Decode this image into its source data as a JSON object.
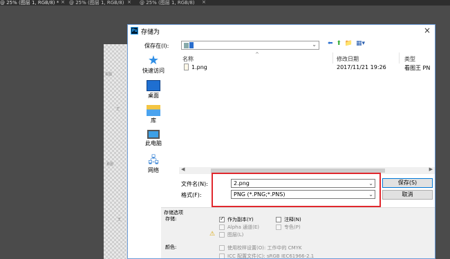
{
  "ps_tabs": [
    {
      "label": "@ 25% (图层 1, RGB/8) *",
      "active": true
    },
    {
      "label": "@ 25% (图层 1, RGB/8)",
      "active": false
    },
    {
      "label": "@ 25% (图层 1, RGB/8)",
      "active": false
    }
  ],
  "canvas_text": [
    "看图",
    "王",
    "看图",
    "王"
  ],
  "dialog": {
    "title": "存储为",
    "logo_text": "Ps",
    "close_label": "×",
    "save_in_label": "保存在(I):",
    "save_in_value": "",
    "toolbar": {
      "back": "⬅",
      "up": "⬆",
      "new_folder": "📁",
      "views": "▦▾"
    }
  },
  "places": [
    {
      "label": "快速访问",
      "icon": "star-icon"
    },
    {
      "label": "桌面",
      "icon": "desktop-icon"
    },
    {
      "label": "库",
      "icon": "library-icon"
    },
    {
      "label": "此电脑",
      "icon": "computer-icon"
    },
    {
      "label": "网络",
      "icon": "network-icon"
    }
  ],
  "file_list": {
    "columns": [
      "名称",
      "修改日期",
      "类型"
    ],
    "rows": [
      {
        "name": "1.png",
        "modified": "2017/11/21 19:26",
        "type": "看图王 PN"
      }
    ]
  },
  "filename": {
    "label": "文件名(N):",
    "value": "2.png"
  },
  "format": {
    "label": "格式(F):",
    "value": "PNG (*.PNG;*.PNS)"
  },
  "buttons": {
    "save": "保存(S)",
    "cancel": "取消"
  },
  "options": {
    "header": "存储选项",
    "store_label": "存储:",
    "as_copy": "作为副本(Y)",
    "alpha": "Alpha 通道(E)",
    "layers": "图层(L)",
    "notes": "注释(N)",
    "spot": "专色(P)",
    "color_label": "颜色:",
    "use_proof": "使用校样设置(O): 工作中的 CMYK",
    "icc": "ICC 配置文件(C): sRGB IEC61966-2.1"
  },
  "colors": {
    "highlight": "#e0272d",
    "accent": "#0078d7"
  }
}
